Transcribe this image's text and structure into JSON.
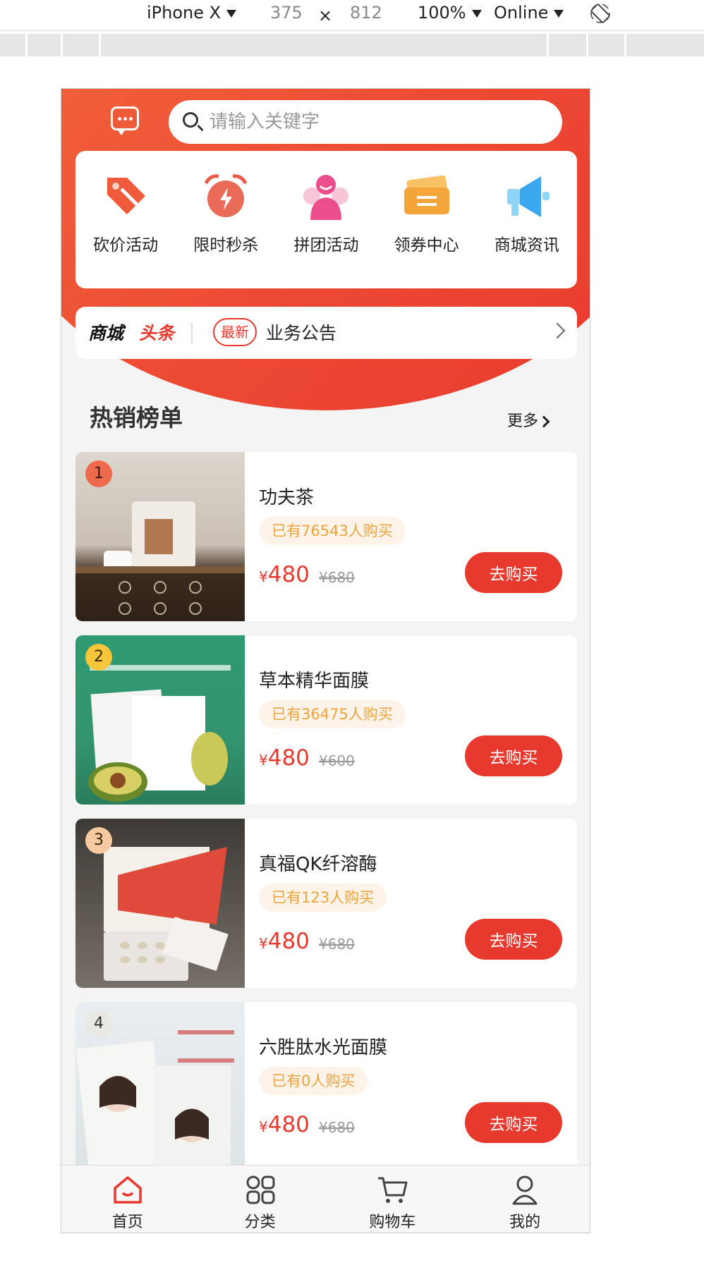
{
  "devtools": {
    "device": "iPhone X",
    "width": "375",
    "times": "×",
    "height": "812",
    "zoom": "100%",
    "network": "Online"
  },
  "search": {
    "placeholder": "请输入关键字"
  },
  "quick_actions": [
    {
      "label": "砍价活动",
      "icon": "price-tag-icon"
    },
    {
      "label": "限时秒杀",
      "icon": "alarm-clock-icon"
    },
    {
      "label": "拼团活动",
      "icon": "group-user-icon"
    },
    {
      "label": "领券中心",
      "icon": "coupon-icon"
    },
    {
      "label": "商城资讯",
      "icon": "megaphone-icon"
    }
  ],
  "notice": {
    "title_a": "商城",
    "title_b": "头条",
    "tag": "最新",
    "text": "业务公告"
  },
  "hot": {
    "title": "热销榜单",
    "more": "更多"
  },
  "products": [
    {
      "rank": "1",
      "name": "功夫茶",
      "sold": "已有76543人购买",
      "price": "480",
      "old_price": "¥680",
      "currency": "¥",
      "buy": "去购买"
    },
    {
      "rank": "2",
      "name": "草本精华面膜",
      "sold": "已有36475人购买",
      "price": "480",
      "old_price": "¥600",
      "currency": "¥",
      "buy": "去购买"
    },
    {
      "rank": "3",
      "name": "真福QK纤溶酶",
      "sold": "已有123人购买",
      "price": "480",
      "old_price": "¥680",
      "currency": "¥",
      "buy": "去购买"
    },
    {
      "rank": "4",
      "name": "六胜肽水光面膜",
      "sold": "已有0人购买",
      "price": "480",
      "old_price": "¥680",
      "currency": "¥",
      "buy": "去购买"
    }
  ],
  "tabbar": [
    {
      "label": "首页",
      "icon": "home-icon"
    },
    {
      "label": "分类",
      "icon": "category-grid-icon"
    },
    {
      "label": "购物车",
      "icon": "cart-icon"
    },
    {
      "label": "我的",
      "icon": "profile-icon"
    }
  ],
  "colors": {
    "brand": "#e8392e",
    "badge_bg": "#fdf3e8",
    "badge_text": "#f0a33d"
  }
}
